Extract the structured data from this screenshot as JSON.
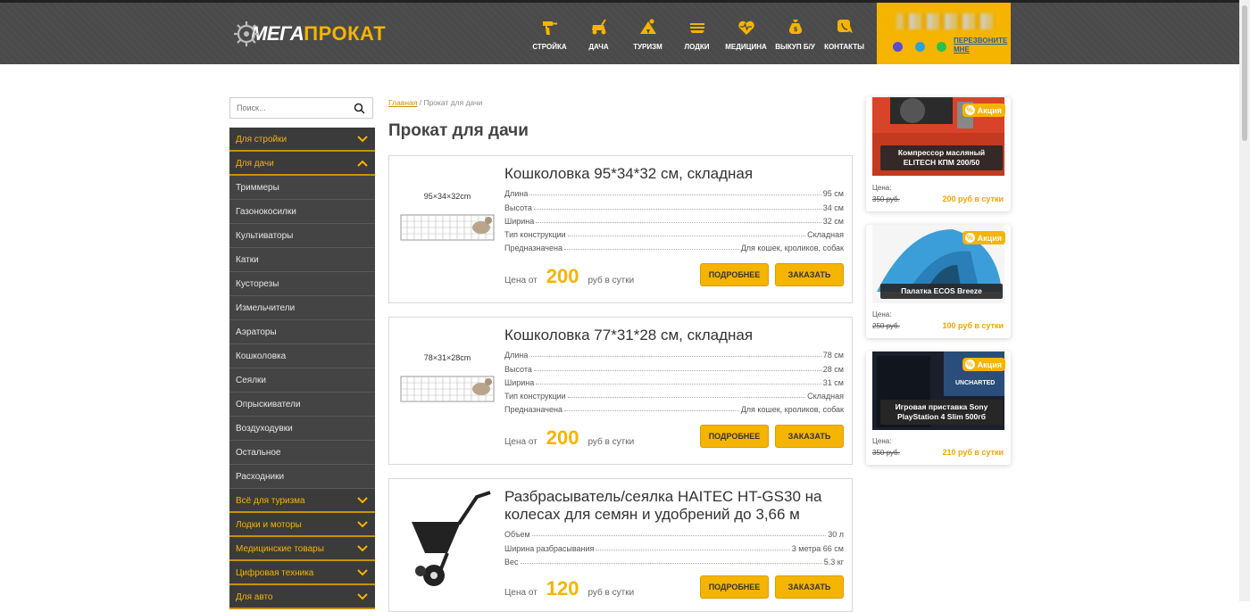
{
  "header": {
    "logo_part1": "МЕГА",
    "logo_part2": "ПРОКАТ",
    "nav": [
      {
        "label": "СТРОЙКА",
        "icon": "drill-icon"
      },
      {
        "label": "ДАЧА",
        "icon": "lawnmower-icon"
      },
      {
        "label": "ТУРИЗМ",
        "icon": "tent-icon"
      },
      {
        "label": "ЛОДКИ",
        "icon": "boat-icon"
      },
      {
        "label": "МЕДИЦИНА",
        "icon": "heart-pulse-icon"
      },
      {
        "label": "ВЫКУП Б/У",
        "icon": "money-bag-icon"
      },
      {
        "label": "КОНТАКТЫ",
        "icon": "phone-chat-icon"
      }
    ],
    "callback": "ПЕРЕЗВОНИТЕ МНЕ",
    "accent": "#f5b400"
  },
  "search": {
    "placeholder": "Поиск..."
  },
  "sidebar": {
    "items": [
      {
        "label": "Для стройки",
        "type": "main",
        "chevron": "down"
      },
      {
        "label": "Для дачи",
        "type": "main",
        "chevron": "up"
      },
      {
        "label": "Триммеры",
        "type": "sub"
      },
      {
        "label": "Газонокосилки",
        "type": "sub"
      },
      {
        "label": "Культиваторы",
        "type": "sub"
      },
      {
        "label": "Катки",
        "type": "sub"
      },
      {
        "label": "Кусторезы",
        "type": "sub"
      },
      {
        "label": "Измельчители",
        "type": "sub"
      },
      {
        "label": "Аэраторы",
        "type": "sub"
      },
      {
        "label": "Кошколовка",
        "type": "sub"
      },
      {
        "label": "Сеялки",
        "type": "sub"
      },
      {
        "label": "Опрыскиватели",
        "type": "sub"
      },
      {
        "label": "Воздуходувки",
        "type": "sub"
      },
      {
        "label": "Остальное",
        "type": "sub"
      },
      {
        "label": "Расходники",
        "type": "sub"
      },
      {
        "label": "Всё для туризма",
        "type": "main",
        "chevron": "down"
      },
      {
        "label": "Лодки и моторы",
        "type": "main",
        "chevron": "down"
      },
      {
        "label": "Медицинские товары",
        "type": "main",
        "chevron": "down"
      },
      {
        "label": "Цифровая техника",
        "type": "main",
        "chevron": "down"
      },
      {
        "label": "Для авто",
        "type": "main",
        "chevron": "down"
      }
    ]
  },
  "breadcrumb": {
    "home": "Главная",
    "sep": " / ",
    "current": "Прокат для дачи"
  },
  "page_title": "Прокат для дачи",
  "products": [
    {
      "title": "Кошколовка 95*34*32 см, складная",
      "img_caption": "95×34×32cm",
      "props": [
        {
          "k": "Длина",
          "v": "95 см"
        },
        {
          "k": "Высота",
          "v": "34 см"
        },
        {
          "k": "Ширина",
          "v": "32 см"
        },
        {
          "k": "Тип конструкции",
          "v": "Складная"
        },
        {
          "k": "Предназначена",
          "v": "Для кошек, кроликов, собак"
        }
      ],
      "price_prefix": "Цена от",
      "price": "200",
      "price_suffix": "руб в сутки",
      "btn_more": "ПОДРОБНЕЕ",
      "btn_order": "ЗАКАЗАТЬ"
    },
    {
      "title": "Кошколовка 77*31*28 см, складная",
      "img_caption": "78×31×28cm",
      "props": [
        {
          "k": "Длина",
          "v": "78 см"
        },
        {
          "k": "Высота",
          "v": "28 см"
        },
        {
          "k": "Ширина",
          "v": "31 см"
        },
        {
          "k": "Тип конструкции",
          "v": "Складная"
        },
        {
          "k": "Предназначена",
          "v": "Для кошек, кроликов, собак"
        }
      ],
      "price_prefix": "Цена от",
      "price": "200",
      "price_suffix": "руб в сутки",
      "btn_more": "ПОДРОБНЕЕ",
      "btn_order": "ЗАКАЗАТЬ"
    },
    {
      "title": "Разбрасыватель/сеялка HAITEC HT-GS30 на колесах для семян и удобрений до 3,66 м",
      "img_caption": "",
      "props": [
        {
          "k": "Объем",
          "v": "30 л"
        },
        {
          "k": "Ширина разбрасывания",
          "v": "3 метра 66 см"
        },
        {
          "k": "Вес",
          "v": "5.3 кг"
        }
      ],
      "price_prefix": "Цена от",
      "price": "120",
      "price_suffix": "руб в сутки",
      "btn_more": "ПОДРОБНЕЕ",
      "btn_order": "ЗАКАЗАТЬ"
    }
  ],
  "promos": [
    {
      "badge": "Акция",
      "name": "Компрессор масляный ELITECH КПМ 200/50",
      "label": "Цена:",
      "old": "350 руб.",
      "new": "200 руб в сутки"
    },
    {
      "badge": "Акция",
      "name": "Палатка ECOS Breeze",
      "label": "Цена:",
      "old": "250 руб.",
      "new": "100 руб в сутки"
    },
    {
      "badge": "Акция",
      "name": "Игровая приставка Sony PlayStation 4 Slim 500гб",
      "label": "Цена:",
      "old": "350 руб.",
      "new": "210 руб в сутки",
      "img_text": "UNCHARTED"
    }
  ]
}
